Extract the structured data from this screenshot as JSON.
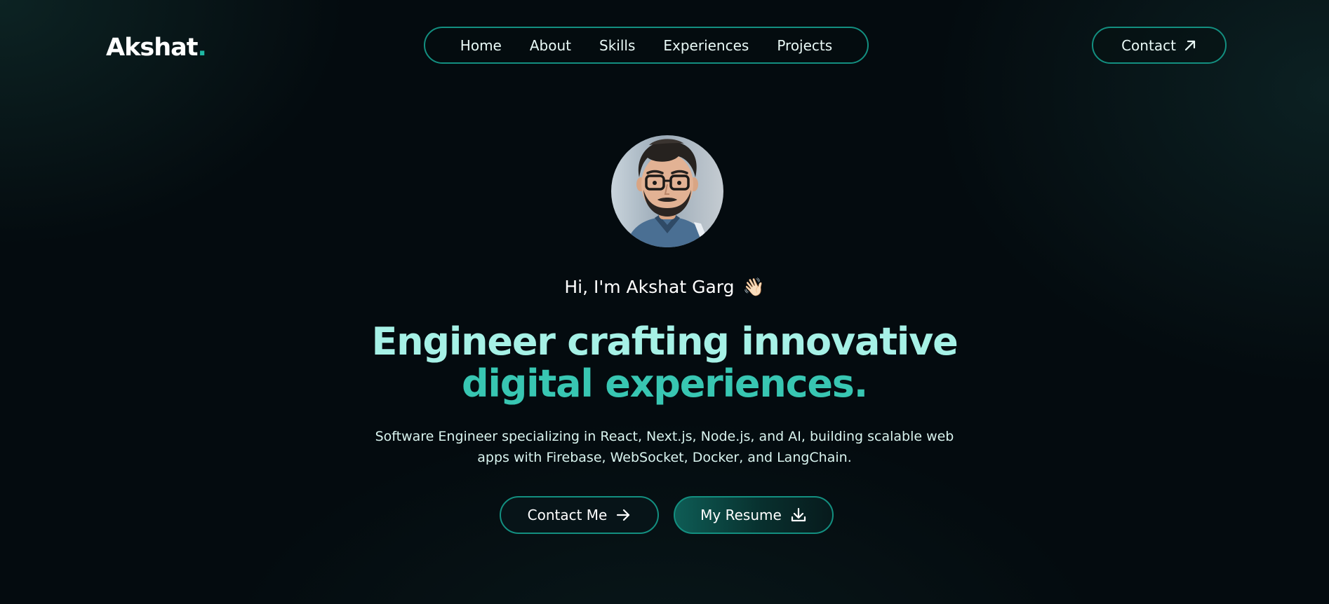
{
  "header": {
    "logo_text": "Akshat",
    "logo_dot": ".",
    "nav": [
      {
        "label": "Home"
      },
      {
        "label": "About"
      },
      {
        "label": "Skills"
      },
      {
        "label": "Experiences"
      },
      {
        "label": "Projects"
      }
    ],
    "contact_label": "Contact",
    "contact_icon": "arrow-up-right-icon"
  },
  "hero": {
    "avatar": "avatar",
    "greeting": "Hi, I'm Akshat Garg",
    "greeting_emoji": "👋🏻",
    "headline_line1": "Engineer crafting innovative",
    "headline_line2": "digital experiences.",
    "subtitle": "Software Engineer specializing in React, Next.js, Node.js, and AI, building scalable web apps with Firebase, WebSocket, Docker, and LangChain.",
    "buttons": {
      "contact_label": "Contact Me",
      "contact_icon": "arrow-right-icon",
      "resume_label": "My Resume",
      "resume_icon": "download-icon"
    }
  },
  "colors": {
    "accent": "#1fb8a4",
    "border": "#138f80",
    "headline_light": "#a6f1e6",
    "headline_dark": "#38c6b2",
    "background": "#040b0f"
  }
}
